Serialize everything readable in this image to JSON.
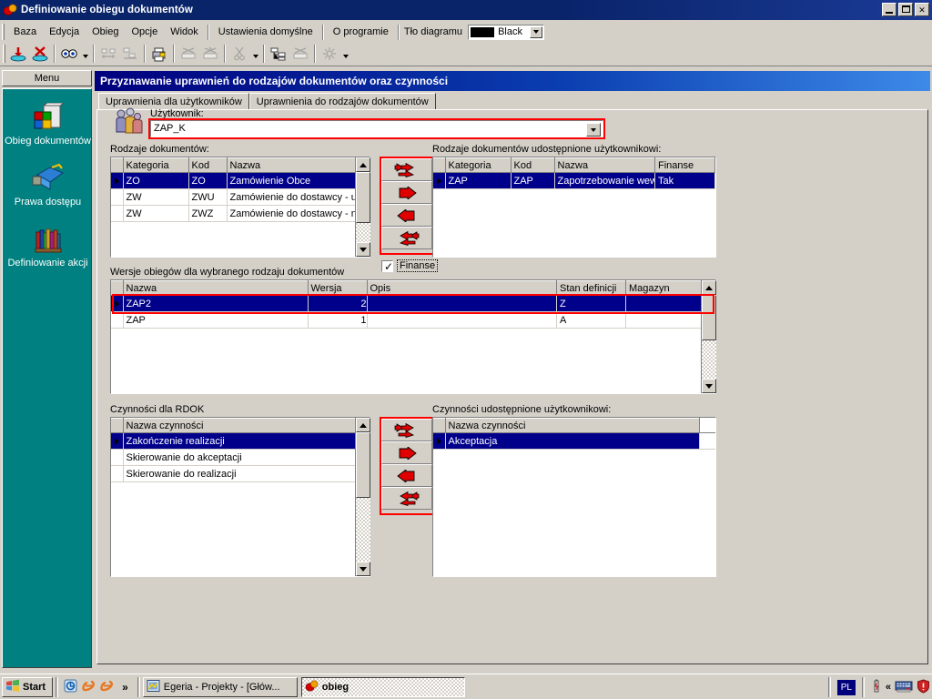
{
  "window": {
    "title": "Definiowanie obiegu dokumentów",
    "icon": "app-cube-icon",
    "buttons": {
      "minimize": "_",
      "maximize": "❐",
      "close": "✕"
    }
  },
  "menubar": {
    "items": [
      {
        "label": "Baza"
      },
      {
        "label": "Edycja"
      },
      {
        "label": "Obieg"
      },
      {
        "label": "Opcje"
      },
      {
        "label": "Widok"
      },
      {
        "label": "Ustawienia domyślne"
      },
      {
        "label": "O programie"
      }
    ],
    "background_label": "Tło diagramu",
    "background_value": "Black",
    "background_color": "#000000"
  },
  "toolbar": {
    "buttons": [
      {
        "name": "save-db-icon",
        "enabled": true
      },
      {
        "name": "delete-db-icon",
        "enabled": true
      },
      {
        "name": "view-glasses-icon",
        "enabled": true,
        "dropdown": true
      },
      {
        "name": "align-horizontal-icon",
        "enabled": false
      },
      {
        "name": "align-vertical-icon",
        "enabled": false
      },
      {
        "name": "print-icon",
        "enabled": true
      },
      {
        "name": "zoom-out-icon",
        "enabled": false
      },
      {
        "name": "zoom-in-icon",
        "enabled": false
      },
      {
        "name": "cut-icon",
        "enabled": false,
        "dropdown": true
      },
      {
        "name": "layout-tree-icon",
        "enabled": true
      },
      {
        "name": "link-break-icon",
        "enabled": false
      },
      {
        "name": "sun-properties-icon",
        "enabled": false,
        "dropdown": true
      }
    ]
  },
  "sidebar": {
    "header": "Menu",
    "accent": "#008080",
    "items": [
      {
        "label": "Obieg dokumentów",
        "icon": "documents-cube-icon"
      },
      {
        "label": "Prawa dostępu",
        "icon": "access-rights-book-icon"
      },
      {
        "label": "Definiowanie akcji",
        "icon": "books-shelf-icon"
      }
    ]
  },
  "main": {
    "title": "Przyznawanie uprawnień do rodzajów dokumentów oraz czynności",
    "title_gradient_from": "#00007d",
    "title_gradient_to": "#3d8ae8",
    "tabs": [
      {
        "label": "Uprawnienia dla użytkowników",
        "active": true
      },
      {
        "label": "Uprawnienia do rodzajów dokumentów",
        "active": false
      }
    ],
    "user": {
      "icon": "users-group-icon",
      "label": "Użytkownik:",
      "value": "ZAP_K",
      "highlight_color": "#ff0000"
    },
    "doc_types": {
      "label": "Rodzaje dokumentów:",
      "columns": [
        "Kategoria",
        "Kod",
        "Nazwa"
      ],
      "rows": [
        {
          "cells": [
            "ZO",
            "ZO",
            "Zamówienie Obce"
          ],
          "selected": true
        },
        {
          "cells": [
            "ZW",
            "ZWU",
            "Zamówienie do dostawcy - uzupełn"
          ],
          "selected": false
        },
        {
          "cells": [
            "ZW",
            "ZWZ",
            "Zamówienie do dostawcy - na pods"
          ],
          "selected": false
        }
      ]
    },
    "doc_transfer": {
      "highlight_color": "#ff0000",
      "buttons": [
        {
          "name": "move-all-right-button",
          "glyph": "all-right-arrows-icon"
        },
        {
          "name": "move-right-button",
          "glyph": "right-arrow-icon"
        },
        {
          "name": "move-left-button",
          "glyph": "left-arrow-icon"
        },
        {
          "name": "move-all-left-button",
          "glyph": "all-left-arrows-icon"
        }
      ],
      "checkbox": {
        "label": "Finanse",
        "checked": true
      }
    },
    "doc_granted": {
      "label": "Rodzaje dokumentów udostępnione użytkownikowi:",
      "columns": [
        "Kategoria",
        "Kod",
        "Nazwa",
        "Finanse"
      ],
      "rows": [
        {
          "cells": [
            "ZAP",
            "ZAP",
            "Zapotrzebowanie wewnę",
            "Tak"
          ],
          "selected": true
        }
      ]
    },
    "versions": {
      "label": "Wersje obiegów dla wybranego rodzaju dokumentów",
      "columns": [
        "Nazwa",
        "Wersja",
        "Opis",
        "Stan definicji",
        "Magazyn"
      ],
      "rows": [
        {
          "cells": [
            "ZAP2",
            "2",
            "",
            "Z",
            ""
          ],
          "selected": true
        },
        {
          "cells": [
            "ZAP",
            "1",
            "",
            "A",
            ""
          ],
          "selected": false
        }
      ],
      "highlight_color": "#ff0000"
    },
    "actions": {
      "label": "Czynności dla RDOK",
      "columns": [
        "Nazwa czynności"
      ],
      "rows": [
        {
          "cells": [
            "Zakończenie realizacji"
          ],
          "selected": true
        },
        {
          "cells": [
            "Skierowanie do akceptacji"
          ],
          "selected": false
        },
        {
          "cells": [
            "Skierowanie do realizacji"
          ],
          "selected": false
        }
      ]
    },
    "actions_transfer": {
      "highlight_color": "#ff0000",
      "buttons": [
        {
          "name": "move-all-right-button",
          "glyph": "all-right-arrows-icon"
        },
        {
          "name": "move-right-button",
          "glyph": "right-arrow-icon"
        },
        {
          "name": "move-left-button",
          "glyph": "left-arrow-icon"
        },
        {
          "name": "move-all-left-button",
          "glyph": "all-left-arrows-icon"
        }
      ]
    },
    "actions_granted": {
      "label": "Czynności udostępnione użytkownikowi:",
      "columns": [
        "Nazwa czynności"
      ],
      "rows": [
        {
          "cells": [
            "Akceptacja"
          ],
          "selected": true
        }
      ]
    }
  },
  "taskbar": {
    "start_label": "Start",
    "quick_launch": [
      {
        "name": "show-desktop-icon"
      },
      {
        "name": "internet-explorer-icon"
      },
      {
        "name": "internet-explorer-2-icon"
      }
    ],
    "overflow": "»",
    "tasks": [
      {
        "label": "Egeria - Projekty - [Głów...",
        "icon": "egeria-icon",
        "active": false
      },
      {
        "label": "obieg",
        "icon": "app-cube-icon",
        "active": true
      }
    ],
    "tray": {
      "language": "PL",
      "icons": [
        "battery-icon",
        "expand-arrows-icon",
        "keyboard-icon",
        "security-shield-icon"
      ]
    }
  }
}
